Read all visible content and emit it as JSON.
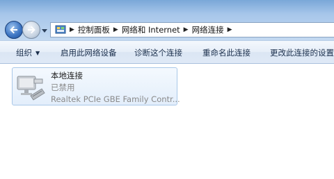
{
  "nav": {
    "back_icon": "back-arrow-icon",
    "forward_icon": "forward-arrow-icon",
    "history_icon": "chevron-down-icon"
  },
  "address": {
    "icon": "control-panel-icon",
    "crumbs": [
      "控制面板",
      "网络和 Internet",
      "网络连接"
    ]
  },
  "toolbar": {
    "organize_label": "组织",
    "enable_label": "启用此网络设备",
    "diagnose_label": "诊断这个连接",
    "rename_label": "重命名此连接",
    "settings_label": "更改此连接的设置"
  },
  "connections": [
    {
      "name": "本地连接",
      "status": "已禁用",
      "device": "Realtek PCIe GBE Family Contr...",
      "icon": "network-adapter-disabled-icon"
    }
  ]
}
